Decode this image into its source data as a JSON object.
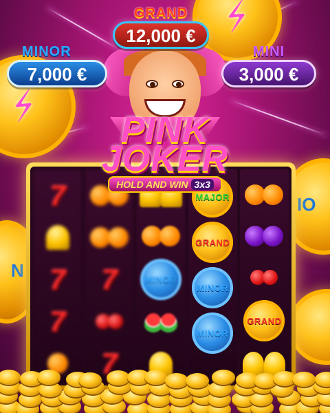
{
  "jackpots": {
    "grand": {
      "label": "GRAND",
      "amount": "12,000 €"
    },
    "minor": {
      "label": "MINOR",
      "amount": "7,000 €"
    },
    "mini": {
      "label": "MINI",
      "amount": "3,000 €"
    }
  },
  "logo": {
    "line1": "PINK",
    "line2": "JOKER",
    "subtitle": "HOLD AND WIN",
    "badge": "3x3"
  },
  "background_coins": {
    "right_word": "IO",
    "left_word": "N"
  },
  "reel_symbols": {
    "major": "MAJOR",
    "grand": "GRAND",
    "minor": "MINOR"
  },
  "colors": {
    "accent_pink": "#ff4fc4",
    "gold": "#ffc21a",
    "grand_red": "#ff3a2a",
    "minor_blue": "#2fa6ff",
    "mini_purple": "#c45cff"
  }
}
